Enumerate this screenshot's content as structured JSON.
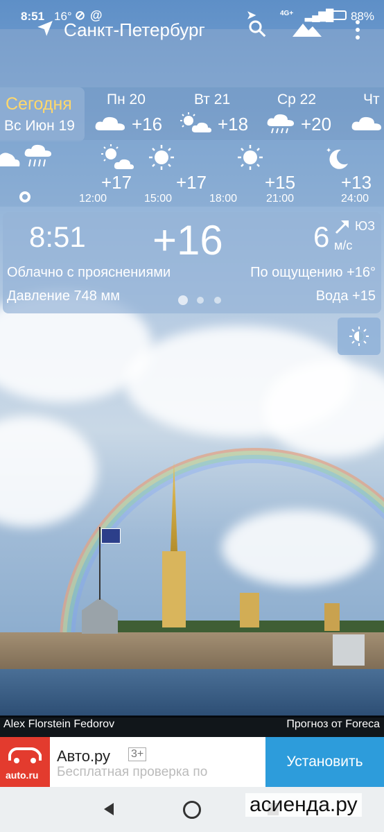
{
  "status_bar": {
    "time": "8:51",
    "extra": "16°",
    "battery": "88%",
    "signal": "4G+"
  },
  "header": {
    "city": "Санкт-Петербург"
  },
  "today": {
    "label": "Сегодня",
    "date": "Вс Июн 19"
  },
  "daily": [
    {
      "name": "Пн 20",
      "temp": "+16",
      "icon": "partly-cloudy-icon"
    },
    {
      "name": "Вт 21",
      "temp": "+18",
      "icon": "sun-cloud-icon"
    },
    {
      "name": "Ср 22",
      "temp": "+20",
      "icon": "rain-cloud-icon"
    },
    {
      "name": "Чт",
      "temp": "",
      "icon": "cloud-icon"
    }
  ],
  "hourly": [
    {
      "time": "12:00",
      "temp": "+17",
      "icon": "sun-cloud-icon"
    },
    {
      "time": "15:00",
      "temp": "+17",
      "icon": "sun-icon"
    },
    {
      "time": "18:00",
      "temp": "",
      "icon": ""
    },
    {
      "time": "21:00",
      "temp": "+15",
      "icon": "sun-icon"
    },
    {
      "time": "24:00",
      "temp": "+13",
      "icon": "moon-stars-icon"
    }
  ],
  "current": {
    "time": "8:51",
    "temp": "+16",
    "wind_speed": "6",
    "wind_unit": "м/с",
    "wind_dir": "ЮЗ",
    "condition": "Облачно с прояснениями",
    "feels_like": "По ощущению +16°",
    "pressure": "Давление 748 мм",
    "water": "Вода +15"
  },
  "credits": {
    "photo": "Alex Florstein Fedorov",
    "forecast": "Прогноз от Foreca"
  },
  "ad": {
    "logo_text": "auto.ru",
    "title": "Авто.ру",
    "rating": "3+",
    "description": "Бесплатная проверка по",
    "install": "Установить"
  },
  "watermark": "асиенда.ру",
  "colors": {
    "today_accent": "#ffd86b",
    "ad_brand": "#e33b2e",
    "install_button": "#2d9cdb"
  }
}
